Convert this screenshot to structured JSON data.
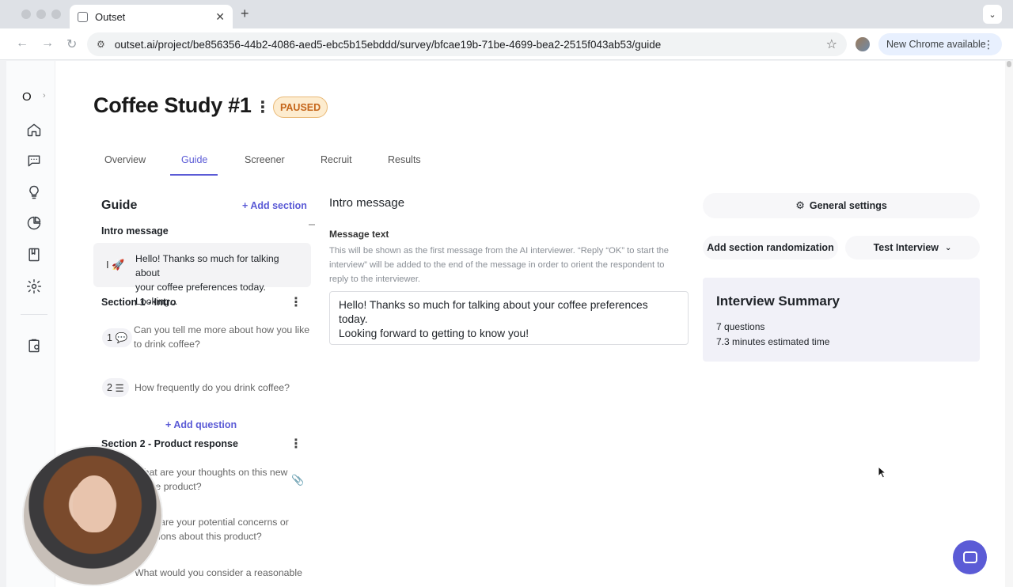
{
  "browser": {
    "tab_title": "Outset",
    "url": "outset.ai/project/be856356-44b2-4086-aed5-ebc5b15ebddd/survey/bfcae19b-71be-4699-bea2-2515f043ab53/guide",
    "update_label": "New Chrome available"
  },
  "rail": {
    "org_initial": "O",
    "chevron": "›"
  },
  "project": {
    "title": "Coffee Study #1",
    "status": "PAUSED"
  },
  "tabs": [
    "Overview",
    "Guide",
    "Screener",
    "Recruit",
    "Results"
  ],
  "active_tab": "Guide",
  "guide": {
    "heading": "Guide",
    "add_section": "Add section",
    "intro_label": "Intro message",
    "intro_preview_line1": "Hello! Thanks so much for talking about",
    "intro_preview_line2": "your coffee preferences today. Looking...",
    "intro_icon_letter": "I",
    "sections": [
      {
        "title": "Section 1 - Intro",
        "questions": [
          {
            "num": "1",
            "line1": "Can you tell me more about how you like",
            "line2": "to drink coffee?"
          },
          {
            "num": "2",
            "line1": "How frequently do you drink coffee?",
            "line2": ""
          }
        ]
      },
      {
        "title": "Section 2 - Product response",
        "questions": [
          {
            "num": "",
            "line1": "What are your thoughts on this new",
            "line2": "coffee product?"
          },
          {
            "num": "",
            "line1": "What are your potential concerns or",
            "line2": "questions about this product?"
          },
          {
            "num": "",
            "line1": "What would you consider a reasonable",
            "line2": ""
          }
        ]
      }
    ],
    "add_question": "Add question"
  },
  "intro_editor": {
    "heading": "Intro message",
    "field_label": "Message text",
    "help_text": "This will be shown as the first message from the AI interviewer. “Reply “OK” to start the interview” will be added to the end of the message in order to orient the respondent to reply to the interviewer.",
    "message_line1": "Hello! Thanks so much for talking about your coffee preferences today.",
    "message_line2": "Looking forward to getting to know you!"
  },
  "settings": {
    "general_settings": "General settings",
    "randomization": "Add section randomization",
    "test_interview": "Test Interview"
  },
  "summary": {
    "title": "Interview Summary",
    "questions": "7 questions",
    "time": "7.3 minutes estimated time"
  },
  "colors": {
    "accent": "#5b5bd6",
    "paused_bg": "#fdeccf",
    "paused_text": "#c5661b",
    "summary_bg": "#f1f1f8"
  }
}
